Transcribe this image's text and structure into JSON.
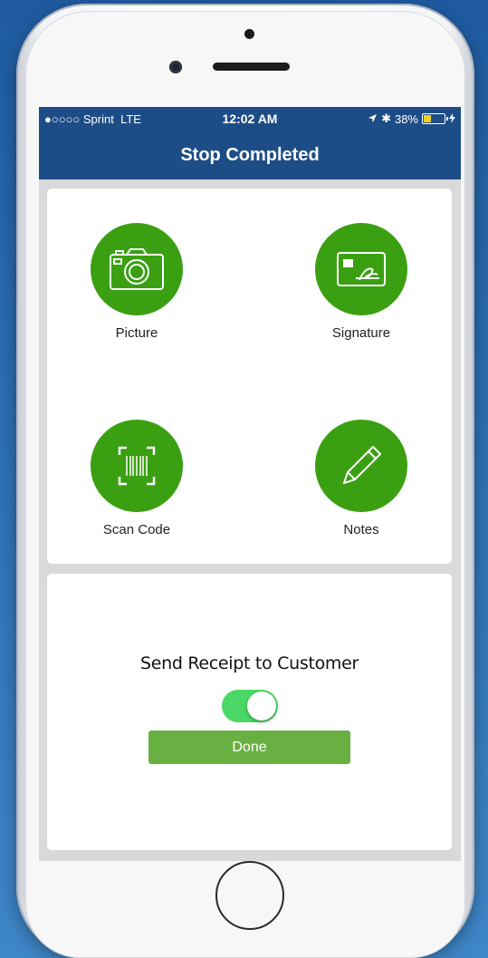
{
  "status_bar": {
    "signal": "●○○○○",
    "carrier": "Sprint",
    "network": "LTE",
    "time": "12:02 AM",
    "bluetooth_glyph": "✱",
    "battery_percent": "38%",
    "battery_level": 0.38
  },
  "nav": {
    "title": "Stop Completed"
  },
  "actions": [
    {
      "label": "Picture",
      "icon": "camera-icon"
    },
    {
      "label": "Signature",
      "icon": "signature-icon"
    },
    {
      "label": "Scan Code",
      "icon": "barcode-icon"
    },
    {
      "label": "Notes",
      "icon": "pencil-icon"
    }
  ],
  "receipt": {
    "label": "Send Receipt to Customer",
    "toggle_on": true
  },
  "done_button": {
    "label": "Done"
  },
  "colors": {
    "nav_bar": "#1d4d86",
    "action_green": "#3aa012",
    "done_green": "#69b043",
    "toggle_green": "#4bd765"
  }
}
